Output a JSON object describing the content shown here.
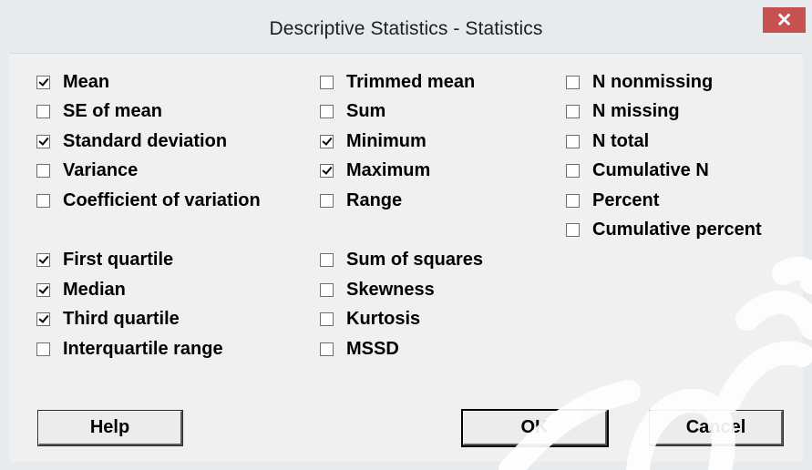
{
  "window": {
    "title": "Descriptive Statistics - Statistics",
    "close_label": "✕"
  },
  "options": {
    "col1": [
      {
        "label": "Mean",
        "checked": true
      },
      {
        "label": "SE of mean",
        "checked": false
      },
      {
        "label": "Standard deviation",
        "checked": true
      },
      {
        "label": "Variance",
        "checked": false
      },
      {
        "label": "Coefficient of variation",
        "checked": false
      },
      {
        "label": "First quartile",
        "checked": true
      },
      {
        "label": "Median",
        "checked": true
      },
      {
        "label": "Third quartile",
        "checked": true
      },
      {
        "label": "Interquartile range",
        "checked": false
      }
    ],
    "col2": [
      {
        "label": "Trimmed mean",
        "checked": false
      },
      {
        "label": "Sum",
        "checked": false
      },
      {
        "label": "Minimum",
        "checked": true
      },
      {
        "label": "Maximum",
        "checked": true
      },
      {
        "label": "Range",
        "checked": false
      },
      {
        "label": "Sum of squares",
        "checked": false
      },
      {
        "label": "Skewness",
        "checked": false
      },
      {
        "label": "Kurtosis",
        "checked": false
      },
      {
        "label": "MSSD",
        "checked": false
      }
    ],
    "col3": [
      {
        "label": "N nonmissing",
        "checked": false
      },
      {
        "label": "N missing",
        "checked": false
      },
      {
        "label": "N total",
        "checked": false
      },
      {
        "label": "Cumulative N",
        "checked": false
      },
      {
        "label": "Percent",
        "checked": false
      },
      {
        "label": "Cumulative percent",
        "checked": false
      }
    ]
  },
  "buttons": {
    "help": "Help",
    "ok": "OK",
    "cancel": "Cancel"
  },
  "colors": {
    "close_button": "#c75050",
    "dialog_background": "#f0f0f0"
  }
}
